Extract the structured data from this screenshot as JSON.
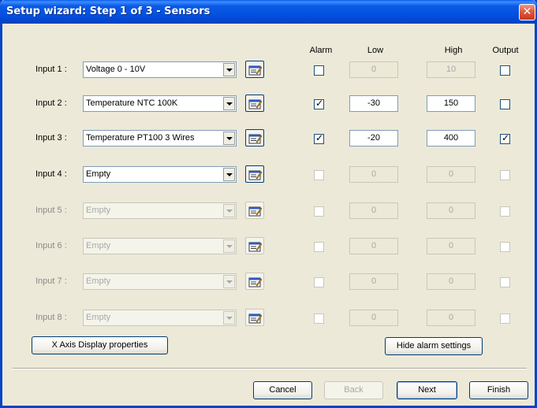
{
  "window": {
    "title": "Setup wizard: Step 1 of 3 - Sensors"
  },
  "headers": {
    "alarm": "Alarm",
    "low": "Low",
    "high": "High",
    "output": "Output"
  },
  "inputs": [
    {
      "label": "Input 1 :",
      "sensor": "Voltage 0 - 10V",
      "enabled": true,
      "alarm": false,
      "alarm_enabled": true,
      "low": "0",
      "high": "10",
      "limits_enabled": false,
      "output": false,
      "output_enabled": true
    },
    {
      "label": "Input 2 :",
      "sensor": "Temperature NTC 100K",
      "enabled": true,
      "alarm": true,
      "alarm_enabled": true,
      "low": "-30",
      "high": "150",
      "limits_enabled": true,
      "output": false,
      "output_enabled": true
    },
    {
      "label": "Input 3 :",
      "sensor": "Temperature PT100 3 Wires",
      "enabled": true,
      "alarm": true,
      "alarm_enabled": true,
      "low": "-20",
      "high": "400",
      "limits_enabled": true,
      "output": true,
      "output_enabled": true
    },
    {
      "label": "Input 4 :",
      "sensor": "Empty",
      "enabled": true,
      "alarm": false,
      "alarm_enabled": false,
      "low": "0",
      "high": "0",
      "limits_enabled": false,
      "output": false,
      "output_enabled": false
    },
    {
      "label": "Input 5 :",
      "sensor": "Empty",
      "enabled": false,
      "alarm": false,
      "alarm_enabled": false,
      "low": "0",
      "high": "0",
      "limits_enabled": false,
      "output": false,
      "output_enabled": false
    },
    {
      "label": "Input 6 :",
      "sensor": "Empty",
      "enabled": false,
      "alarm": false,
      "alarm_enabled": false,
      "low": "0",
      "high": "0",
      "limits_enabled": false,
      "output": false,
      "output_enabled": false
    },
    {
      "label": "Input 7 :",
      "sensor": "Empty",
      "enabled": false,
      "alarm": false,
      "alarm_enabled": false,
      "low": "0",
      "high": "0",
      "limits_enabled": false,
      "output": false,
      "output_enabled": false
    },
    {
      "label": "Input 8 :",
      "sensor": "Empty",
      "enabled": false,
      "alarm": false,
      "alarm_enabled": false,
      "low": "0",
      "high": "0",
      "limits_enabled": false,
      "output": false,
      "output_enabled": false
    }
  ],
  "buttons": {
    "x_axis": "X Axis Display properties",
    "hide_alarm": "Hide alarm settings",
    "cancel": "Cancel",
    "back": "Back",
    "next": "Next",
    "finish": "Finish"
  },
  "icons": {
    "close": "close-icon",
    "properties": "properties-icon",
    "dropdown": "chevron-down-icon"
  },
  "colors": {
    "titlebar": "#0452e0",
    "dialog_bg": "#ece9d8",
    "close_button": "#e3583c"
  }
}
